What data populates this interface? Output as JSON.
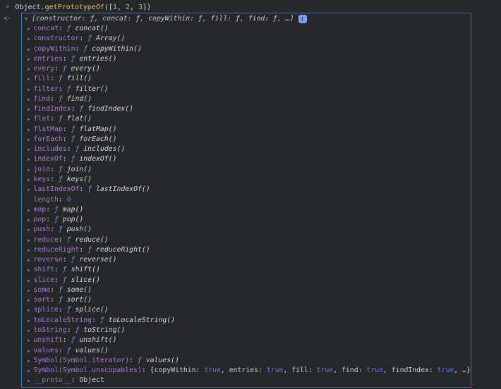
{
  "input": {
    "prompt": ">",
    "segments": [
      {
        "t": "Object.",
        "c": "base"
      },
      {
        "t": "getPrototypeOf",
        "c": "method"
      },
      {
        "t": "([",
        "c": "base"
      },
      {
        "t": "1",
        "c": "inputnum"
      },
      {
        "t": ", ",
        "c": "base"
      },
      {
        "t": "2",
        "c": "inputnum"
      },
      {
        "t": ", ",
        "c": "base"
      },
      {
        "t": "3",
        "c": "inputnum"
      },
      {
        "t": "])",
        "c": "base"
      }
    ]
  },
  "result": {
    "icon_lt": "<",
    "icon_dot": "·"
  },
  "preview": {
    "arrow": "▼",
    "text": "[constructor: ƒ, concat: ƒ, copyWithin: ƒ, fill: ƒ, find: ƒ, …]",
    "badge": "i"
  },
  "rows": [
    {
      "arrow": "▶",
      "parts": [
        {
          "t": "concat",
          "c": "name"
        },
        {
          "t": ": ",
          "c": "base"
        },
        {
          "t": "ƒ ",
          "c": "fn"
        },
        {
          "t": "concat()",
          "c": "fnname"
        }
      ]
    },
    {
      "arrow": "▶",
      "parts": [
        {
          "t": "constructor",
          "c": "name"
        },
        {
          "t": ": ",
          "c": "base"
        },
        {
          "t": "ƒ ",
          "c": "fn"
        },
        {
          "t": "Array()",
          "c": "fnname"
        }
      ]
    },
    {
      "arrow": "▶",
      "parts": [
        {
          "t": "copyWithin",
          "c": "name"
        },
        {
          "t": ": ",
          "c": "base"
        },
        {
          "t": "ƒ ",
          "c": "fn"
        },
        {
          "t": "copyWithin()",
          "c": "fnname"
        }
      ]
    },
    {
      "arrow": "▶",
      "parts": [
        {
          "t": "entries",
          "c": "name"
        },
        {
          "t": ": ",
          "c": "base"
        },
        {
          "t": "ƒ ",
          "c": "fn"
        },
        {
          "t": "entries()",
          "c": "fnname"
        }
      ]
    },
    {
      "arrow": "▶",
      "parts": [
        {
          "t": "every",
          "c": "name"
        },
        {
          "t": ": ",
          "c": "base"
        },
        {
          "t": "ƒ ",
          "c": "fn"
        },
        {
          "t": "every()",
          "c": "fnname"
        }
      ]
    },
    {
      "arrow": "▶",
      "parts": [
        {
          "t": "fill",
          "c": "name"
        },
        {
          "t": ": ",
          "c": "base"
        },
        {
          "t": "ƒ ",
          "c": "fn"
        },
        {
          "t": "fill()",
          "c": "fnname"
        }
      ]
    },
    {
      "arrow": "▶",
      "parts": [
        {
          "t": "filter",
          "c": "name"
        },
        {
          "t": ": ",
          "c": "base"
        },
        {
          "t": "ƒ ",
          "c": "fn"
        },
        {
          "t": "filter()",
          "c": "fnname"
        }
      ]
    },
    {
      "arrow": "▶",
      "parts": [
        {
          "t": "find",
          "c": "name"
        },
        {
          "t": ": ",
          "c": "base"
        },
        {
          "t": "ƒ ",
          "c": "fn"
        },
        {
          "t": "find()",
          "c": "fnname"
        }
      ]
    },
    {
      "arrow": "▶",
      "parts": [
        {
          "t": "findIndex",
          "c": "name"
        },
        {
          "t": ": ",
          "c": "base"
        },
        {
          "t": "ƒ ",
          "c": "fn"
        },
        {
          "t": "findIndex()",
          "c": "fnname"
        }
      ]
    },
    {
      "arrow": "▶",
      "parts": [
        {
          "t": "flat",
          "c": "name"
        },
        {
          "t": ": ",
          "c": "base"
        },
        {
          "t": "ƒ ",
          "c": "fn"
        },
        {
          "t": "flat()",
          "c": "fnname"
        }
      ]
    },
    {
      "arrow": "▶",
      "parts": [
        {
          "t": "flatMap",
          "c": "name"
        },
        {
          "t": ": ",
          "c": "base"
        },
        {
          "t": "ƒ ",
          "c": "fn"
        },
        {
          "t": "flatMap()",
          "c": "fnname"
        }
      ]
    },
    {
      "arrow": "▶",
      "parts": [
        {
          "t": "forEach",
          "c": "name"
        },
        {
          "t": ": ",
          "c": "base"
        },
        {
          "t": "ƒ ",
          "c": "fn"
        },
        {
          "t": "forEach()",
          "c": "fnname"
        }
      ]
    },
    {
      "arrow": "▶",
      "parts": [
        {
          "t": "includes",
          "c": "name"
        },
        {
          "t": ": ",
          "c": "base"
        },
        {
          "t": "ƒ ",
          "c": "fn"
        },
        {
          "t": "includes()",
          "c": "fnname"
        }
      ]
    },
    {
      "arrow": "▶",
      "parts": [
        {
          "t": "indexOf",
          "c": "name"
        },
        {
          "t": ": ",
          "c": "base"
        },
        {
          "t": "ƒ ",
          "c": "fn"
        },
        {
          "t": "indexOf()",
          "c": "fnname"
        }
      ]
    },
    {
      "arrow": "▶",
      "parts": [
        {
          "t": "join",
          "c": "name"
        },
        {
          "t": ": ",
          "c": "base"
        },
        {
          "t": "ƒ ",
          "c": "fn"
        },
        {
          "t": "join()",
          "c": "fnname"
        }
      ]
    },
    {
      "arrow": "▶",
      "parts": [
        {
          "t": "keys",
          "c": "name"
        },
        {
          "t": ": ",
          "c": "base"
        },
        {
          "t": "ƒ ",
          "c": "fn"
        },
        {
          "t": "keys()",
          "c": "fnname"
        }
      ]
    },
    {
      "arrow": "▶",
      "parts": [
        {
          "t": "lastIndexOf",
          "c": "name"
        },
        {
          "t": ": ",
          "c": "base"
        },
        {
          "t": "ƒ ",
          "c": "fn"
        },
        {
          "t": "lastIndexOf()",
          "c": "fnname"
        }
      ]
    },
    {
      "arrow": "",
      "parts": [
        {
          "t": "length",
          "c": "dimname"
        },
        {
          "t": ": ",
          "c": "base"
        },
        {
          "t": "0",
          "c": "num"
        }
      ]
    },
    {
      "arrow": "▶",
      "parts": [
        {
          "t": "map",
          "c": "name"
        },
        {
          "t": ": ",
          "c": "base"
        },
        {
          "t": "ƒ ",
          "c": "fn"
        },
        {
          "t": "map()",
          "c": "fnname"
        }
      ]
    },
    {
      "arrow": "▶",
      "parts": [
        {
          "t": "pop",
          "c": "name"
        },
        {
          "t": ": ",
          "c": "base"
        },
        {
          "t": "ƒ ",
          "c": "fn"
        },
        {
          "t": "pop()",
          "c": "fnname"
        }
      ]
    },
    {
      "arrow": "▶",
      "parts": [
        {
          "t": "push",
          "c": "name"
        },
        {
          "t": ": ",
          "c": "base"
        },
        {
          "t": "ƒ ",
          "c": "fn"
        },
        {
          "t": "push()",
          "c": "fnname"
        }
      ]
    },
    {
      "arrow": "▶",
      "parts": [
        {
          "t": "reduce",
          "c": "name"
        },
        {
          "t": ": ",
          "c": "base"
        },
        {
          "t": "ƒ ",
          "c": "fn"
        },
        {
          "t": "reduce()",
          "c": "fnname"
        }
      ]
    },
    {
      "arrow": "▶",
      "parts": [
        {
          "t": "reduceRight",
          "c": "name"
        },
        {
          "t": ": ",
          "c": "base"
        },
        {
          "t": "ƒ ",
          "c": "fn"
        },
        {
          "t": "reduceRight()",
          "c": "fnname"
        }
      ]
    },
    {
      "arrow": "▶",
      "parts": [
        {
          "t": "reverse",
          "c": "name"
        },
        {
          "t": ": ",
          "c": "base"
        },
        {
          "t": "ƒ ",
          "c": "fn"
        },
        {
          "t": "reverse()",
          "c": "fnname"
        }
      ]
    },
    {
      "arrow": "▶",
      "parts": [
        {
          "t": "shift",
          "c": "name"
        },
        {
          "t": ": ",
          "c": "base"
        },
        {
          "t": "ƒ ",
          "c": "fn"
        },
        {
          "t": "shift()",
          "c": "fnname"
        }
      ]
    },
    {
      "arrow": "▶",
      "parts": [
        {
          "t": "slice",
          "c": "name"
        },
        {
          "t": ": ",
          "c": "base"
        },
        {
          "t": "ƒ ",
          "c": "fn"
        },
        {
          "t": "slice()",
          "c": "fnname"
        }
      ]
    },
    {
      "arrow": "▶",
      "parts": [
        {
          "t": "some",
          "c": "name"
        },
        {
          "t": ": ",
          "c": "base"
        },
        {
          "t": "ƒ ",
          "c": "fn"
        },
        {
          "t": "some()",
          "c": "fnname"
        }
      ]
    },
    {
      "arrow": "▶",
      "parts": [
        {
          "t": "sort",
          "c": "name"
        },
        {
          "t": ": ",
          "c": "base"
        },
        {
          "t": "ƒ ",
          "c": "fn"
        },
        {
          "t": "sort()",
          "c": "fnname"
        }
      ]
    },
    {
      "arrow": "▶",
      "parts": [
        {
          "t": "splice",
          "c": "name"
        },
        {
          "t": ": ",
          "c": "base"
        },
        {
          "t": "ƒ ",
          "c": "fn"
        },
        {
          "t": "splice()",
          "c": "fnname"
        }
      ]
    },
    {
      "arrow": "▶",
      "parts": [
        {
          "t": "toLocaleString",
          "c": "name"
        },
        {
          "t": ": ",
          "c": "base"
        },
        {
          "t": "ƒ ",
          "c": "fn"
        },
        {
          "t": "toLocaleString()",
          "c": "fnname"
        }
      ]
    },
    {
      "arrow": "▶",
      "parts": [
        {
          "t": "toString",
          "c": "name"
        },
        {
          "t": ": ",
          "c": "base"
        },
        {
          "t": "ƒ ",
          "c": "fn"
        },
        {
          "t": "toString()",
          "c": "fnname"
        }
      ]
    },
    {
      "arrow": "▶",
      "parts": [
        {
          "t": "unshift",
          "c": "name"
        },
        {
          "t": ": ",
          "c": "base"
        },
        {
          "t": "ƒ ",
          "c": "fn"
        },
        {
          "t": "unshift()",
          "c": "fnname"
        }
      ]
    },
    {
      "arrow": "▶",
      "parts": [
        {
          "t": "values",
          "c": "name"
        },
        {
          "t": ": ",
          "c": "base"
        },
        {
          "t": "ƒ ",
          "c": "fn"
        },
        {
          "t": "values()",
          "c": "fnname"
        }
      ]
    },
    {
      "arrow": "▶",
      "parts": [
        {
          "t": "Symbol(Symbol.iterator)",
          "c": "name"
        },
        {
          "t": ": ",
          "c": "base"
        },
        {
          "t": "ƒ ",
          "c": "fn"
        },
        {
          "t": "values()",
          "c": "fnname"
        }
      ]
    },
    {
      "arrow": "▶",
      "parts": [
        {
          "t": "Symbol(Symbol.unscopables)",
          "c": "name"
        },
        {
          "t": ": ",
          "c": "base"
        },
        {
          "t": "{",
          "c": "base"
        },
        {
          "t": "copyWithin",
          "c": "pkey"
        },
        {
          "t": ": ",
          "c": "base"
        },
        {
          "t": "true",
          "c": "bool"
        },
        {
          "t": ", ",
          "c": "base"
        },
        {
          "t": "entries",
          "c": "pkey"
        },
        {
          "t": ": ",
          "c": "base"
        },
        {
          "t": "true",
          "c": "bool"
        },
        {
          "t": ", ",
          "c": "base"
        },
        {
          "t": "fill",
          "c": "pkey"
        },
        {
          "t": ": ",
          "c": "base"
        },
        {
          "t": "true",
          "c": "bool"
        },
        {
          "t": ", ",
          "c": "base"
        },
        {
          "t": "find",
          "c": "pkey"
        },
        {
          "t": ": ",
          "c": "base"
        },
        {
          "t": "true",
          "c": "bool"
        },
        {
          "t": ", ",
          "c": "base"
        },
        {
          "t": "findIndex",
          "c": "pkey"
        },
        {
          "t": ": ",
          "c": "base"
        },
        {
          "t": "true",
          "c": "bool"
        },
        {
          "t": ", ",
          "c": "base"
        },
        {
          "t": "…}",
          "c": "base"
        }
      ]
    },
    {
      "arrow": "▶",
      "parts": [
        {
          "t": "__proto__",
          "c": "dimname"
        },
        {
          "t": ": ",
          "c": "base"
        },
        {
          "t": "Object",
          "c": "objval"
        }
      ]
    }
  ]
}
